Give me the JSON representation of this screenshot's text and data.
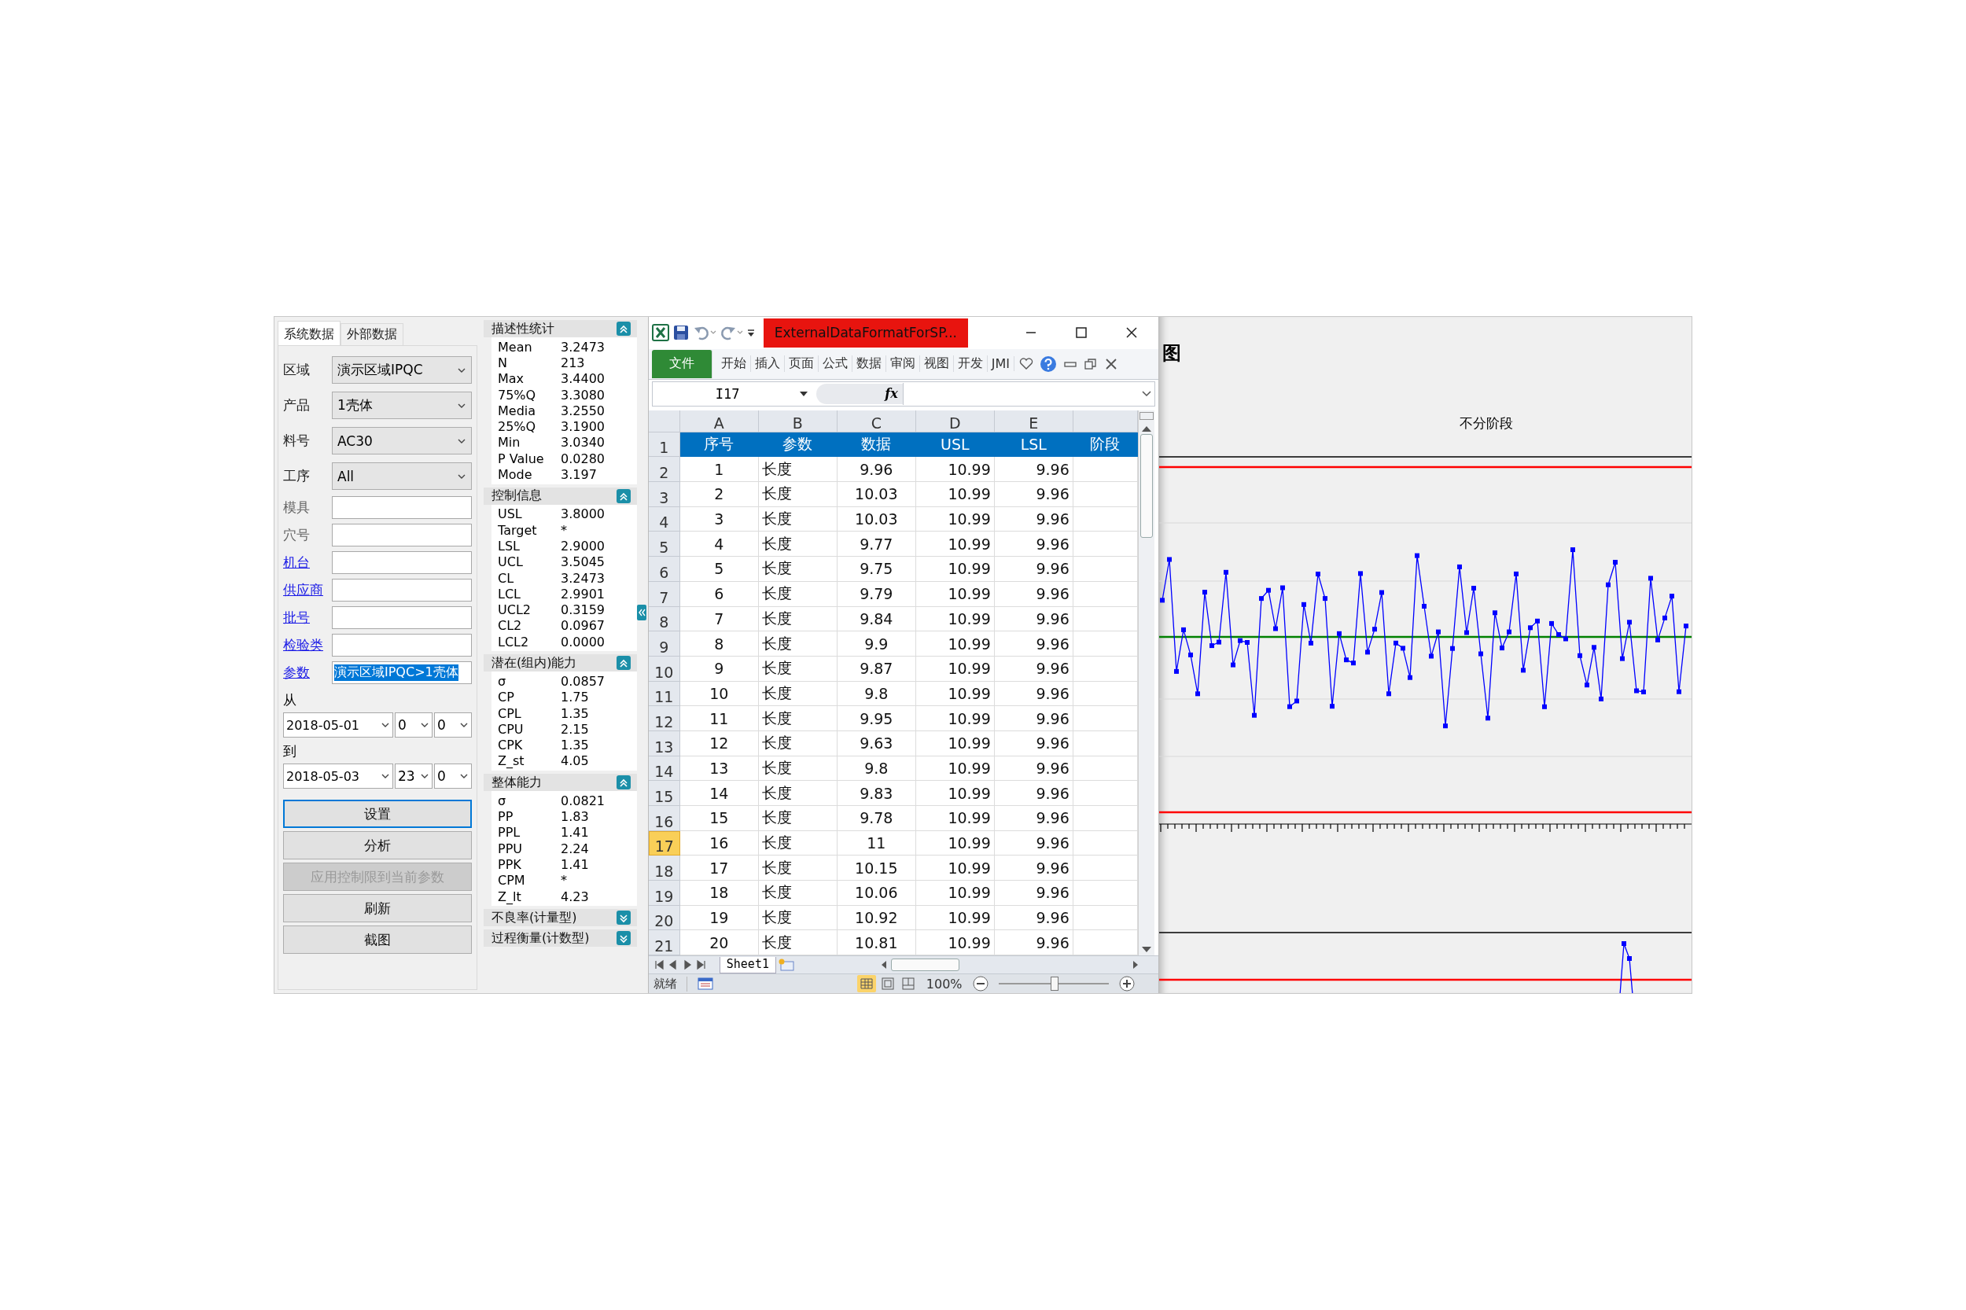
{
  "left_panel": {
    "tabs": [
      {
        "label": "系统数据",
        "selected": true
      },
      {
        "label": "外部数据",
        "selected": false
      }
    ],
    "fields": [
      {
        "kind": "combo",
        "label": "区域",
        "value": "演示区域IPQC"
      },
      {
        "kind": "combo",
        "label": "产品",
        "value": "1壳体"
      },
      {
        "kind": "combo",
        "label": "料号",
        "value": "AC30"
      },
      {
        "kind": "combo",
        "label": "工序",
        "value": "All"
      },
      {
        "kind": "input",
        "label": "模具"
      },
      {
        "kind": "input",
        "label": "穴号"
      },
      {
        "kind": "link_input",
        "label": "机台"
      },
      {
        "kind": "link_input",
        "label": "供应商"
      },
      {
        "kind": "link_input",
        "label": "批号"
      },
      {
        "kind": "link_input",
        "label": "检验类"
      },
      {
        "kind": "link_input",
        "label": "参数",
        "value": "演示区域IPQC>1壳体"
      }
    ],
    "from_label": "从",
    "from": [
      "2018-05-01",
      "0",
      "0"
    ],
    "to_label": "到",
    "to": [
      "2018-05-03",
      "23",
      "0"
    ],
    "buttons": [
      {
        "label": "设置",
        "focused": true,
        "disabled": false
      },
      {
        "label": "分析",
        "focused": false,
        "disabled": false
      },
      {
        "label": "应用控制限到当前参数",
        "focused": false,
        "disabled": true
      },
      {
        "label": "刷新",
        "focused": false,
        "disabled": false
      },
      {
        "label": "截图",
        "focused": false,
        "disabled": false
      }
    ]
  },
  "stats_sections": [
    {
      "title": "描述性统计",
      "expanded": true,
      "rows": [
        [
          "Mean",
          "3.2473"
        ],
        [
          "N",
          "213"
        ],
        [
          "Max",
          "3.4400"
        ],
        [
          "75%Q",
          "3.3080"
        ],
        [
          "Media",
          "3.2550"
        ],
        [
          "25%Q",
          "3.1900"
        ],
        [
          "Min",
          "3.0340"
        ],
        [
          "P Value",
          "0.0280"
        ],
        [
          "Mode",
          "3.197"
        ]
      ]
    },
    {
      "title": "控制信息",
      "expanded": true,
      "rows": [
        [
          "USL",
          "3.8000"
        ],
        [
          "Target",
          "*"
        ],
        [
          "LSL",
          "2.9000"
        ],
        [
          "UCL",
          "3.5045"
        ],
        [
          "CL",
          "3.2473"
        ],
        [
          "LCL",
          "2.9901"
        ],
        [
          "UCL2",
          "0.3159"
        ],
        [
          "CL2",
          "0.0967"
        ],
        [
          "LCL2",
          "0.0000"
        ]
      ]
    },
    {
      "title": "潜在(组内)能力",
      "expanded": true,
      "rows": [
        [
          "σ",
          "0.0857"
        ],
        [
          "CP",
          "1.75"
        ],
        [
          "CPL",
          "1.35"
        ],
        [
          "CPU",
          "2.15"
        ],
        [
          "CPK",
          "1.35"
        ],
        [
          "Z_st",
          "4.05"
        ]
      ]
    },
    {
      "title": "整体能力",
      "expanded": true,
      "rows": [
        [
          "σ",
          "0.0821"
        ],
        [
          "PP",
          "1.83"
        ],
        [
          "PPL",
          "1.41"
        ],
        [
          "PPU",
          "2.24"
        ],
        [
          "PPK",
          "1.41"
        ],
        [
          "CPM",
          "*"
        ],
        [
          "Z_lt",
          "4.23"
        ]
      ]
    },
    {
      "title": "不良率(计量型)",
      "expanded": false
    },
    {
      "title": "过程衡量(计数型)",
      "expanded": false
    }
  ],
  "excel": {
    "title": "ExternalDataFormatForSP...",
    "ribbon_tabs": [
      {
        "label": "文件",
        "selected": true
      },
      {
        "label": "开始",
        "selected": false
      },
      {
        "label": "插入",
        "selected": false
      },
      {
        "label": "页面",
        "selected": false
      },
      {
        "label": "公式",
        "selected": false
      },
      {
        "label": "数据",
        "selected": false
      },
      {
        "label": "审阅",
        "selected": false
      },
      {
        "label": "视图",
        "selected": false
      },
      {
        "label": "开发",
        "selected": false
      },
      {
        "label": "JMI",
        "selected": false
      }
    ],
    "name_box": "I17",
    "fx_label": "fx",
    "columns": [
      "A",
      "B",
      "C",
      "D",
      "E"
    ],
    "rows": [
      {
        "number": "1",
        "kind": "header",
        "selected": false,
        "cells": [
          "序号",
          "参数",
          "数据",
          "USL",
          "LSL",
          "阶段"
        ]
      },
      {
        "number": "2",
        "kind": "data",
        "selected": false,
        "cells": [
          "1",
          "长度",
          "9.96",
          "10.99",
          "9.96"
        ]
      },
      {
        "number": "3",
        "kind": "data",
        "selected": false,
        "cells": [
          "2",
          "长度",
          "10.03",
          "10.99",
          "9.96"
        ]
      },
      {
        "number": "4",
        "kind": "data",
        "selected": false,
        "cells": [
          "3",
          "长度",
          "10.03",
          "10.99",
          "9.96"
        ]
      },
      {
        "number": "5",
        "kind": "data",
        "selected": false,
        "cells": [
          "4",
          "长度",
          "9.77",
          "10.99",
          "9.96"
        ]
      },
      {
        "number": "6",
        "kind": "data",
        "selected": false,
        "cells": [
          "5",
          "长度",
          "9.75",
          "10.99",
          "9.96"
        ]
      },
      {
        "number": "7",
        "kind": "data",
        "selected": false,
        "cells": [
          "6",
          "长度",
          "9.79",
          "10.99",
          "9.96"
        ]
      },
      {
        "number": "8",
        "kind": "data",
        "selected": false,
        "cells": [
          "7",
          "长度",
          "9.84",
          "10.99",
          "9.96"
        ]
      },
      {
        "number": "9",
        "kind": "data",
        "selected": false,
        "cells": [
          "8",
          "长度",
          "9.9",
          "10.99",
          "9.96"
        ]
      },
      {
        "number": "10",
        "kind": "data",
        "selected": false,
        "cells": [
          "9",
          "长度",
          "9.87",
          "10.99",
          "9.96"
        ]
      },
      {
        "number": "11",
        "kind": "data",
        "selected": false,
        "cells": [
          "10",
          "长度",
          "9.8",
          "10.99",
          "9.96"
        ]
      },
      {
        "number": "12",
        "kind": "data",
        "selected": false,
        "cells": [
          "11",
          "长度",
          "9.95",
          "10.99",
          "9.96"
        ]
      },
      {
        "number": "13",
        "kind": "data",
        "selected": false,
        "cells": [
          "12",
          "长度",
          "9.63",
          "10.99",
          "9.96"
        ]
      },
      {
        "number": "14",
        "kind": "data",
        "selected": false,
        "cells": [
          "13",
          "长度",
          "9.8",
          "10.99",
          "9.96"
        ]
      },
      {
        "number": "15",
        "kind": "data",
        "selected": false,
        "cells": [
          "14",
          "长度",
          "9.83",
          "10.99",
          "9.96"
        ]
      },
      {
        "number": "16",
        "kind": "data",
        "selected": false,
        "cells": [
          "15",
          "长度",
          "9.78",
          "10.99",
          "9.96"
        ]
      },
      {
        "number": "17",
        "kind": "data",
        "selected": true,
        "cells": [
          "16",
          "长度",
          "11",
          "10.99",
          "9.96"
        ]
      },
      {
        "number": "18",
        "kind": "data",
        "selected": false,
        "cells": [
          "17",
          "长度",
          "10.15",
          "10.99",
          "9.96"
        ]
      },
      {
        "number": "19",
        "kind": "data",
        "selected": false,
        "cells": [
          "18",
          "长度",
          "10.06",
          "10.99",
          "9.96"
        ]
      },
      {
        "number": "20",
        "kind": "data",
        "selected": false,
        "cells": [
          "19",
          "长度",
          "10.92",
          "10.99",
          "9.96"
        ]
      },
      {
        "number": "21",
        "kind": "data",
        "selected": false,
        "cells": [
          "20",
          "长度",
          "10.81",
          "10.99",
          "9.96"
        ]
      }
    ],
    "sheet_tab": "Sheet1",
    "status": "就绪",
    "zoom": "100%",
    "zoom_slider": {
      "level": 0.5
    }
  },
  "chart": {
    "title": "图",
    "phase_label": "不分阶段"
  }
}
